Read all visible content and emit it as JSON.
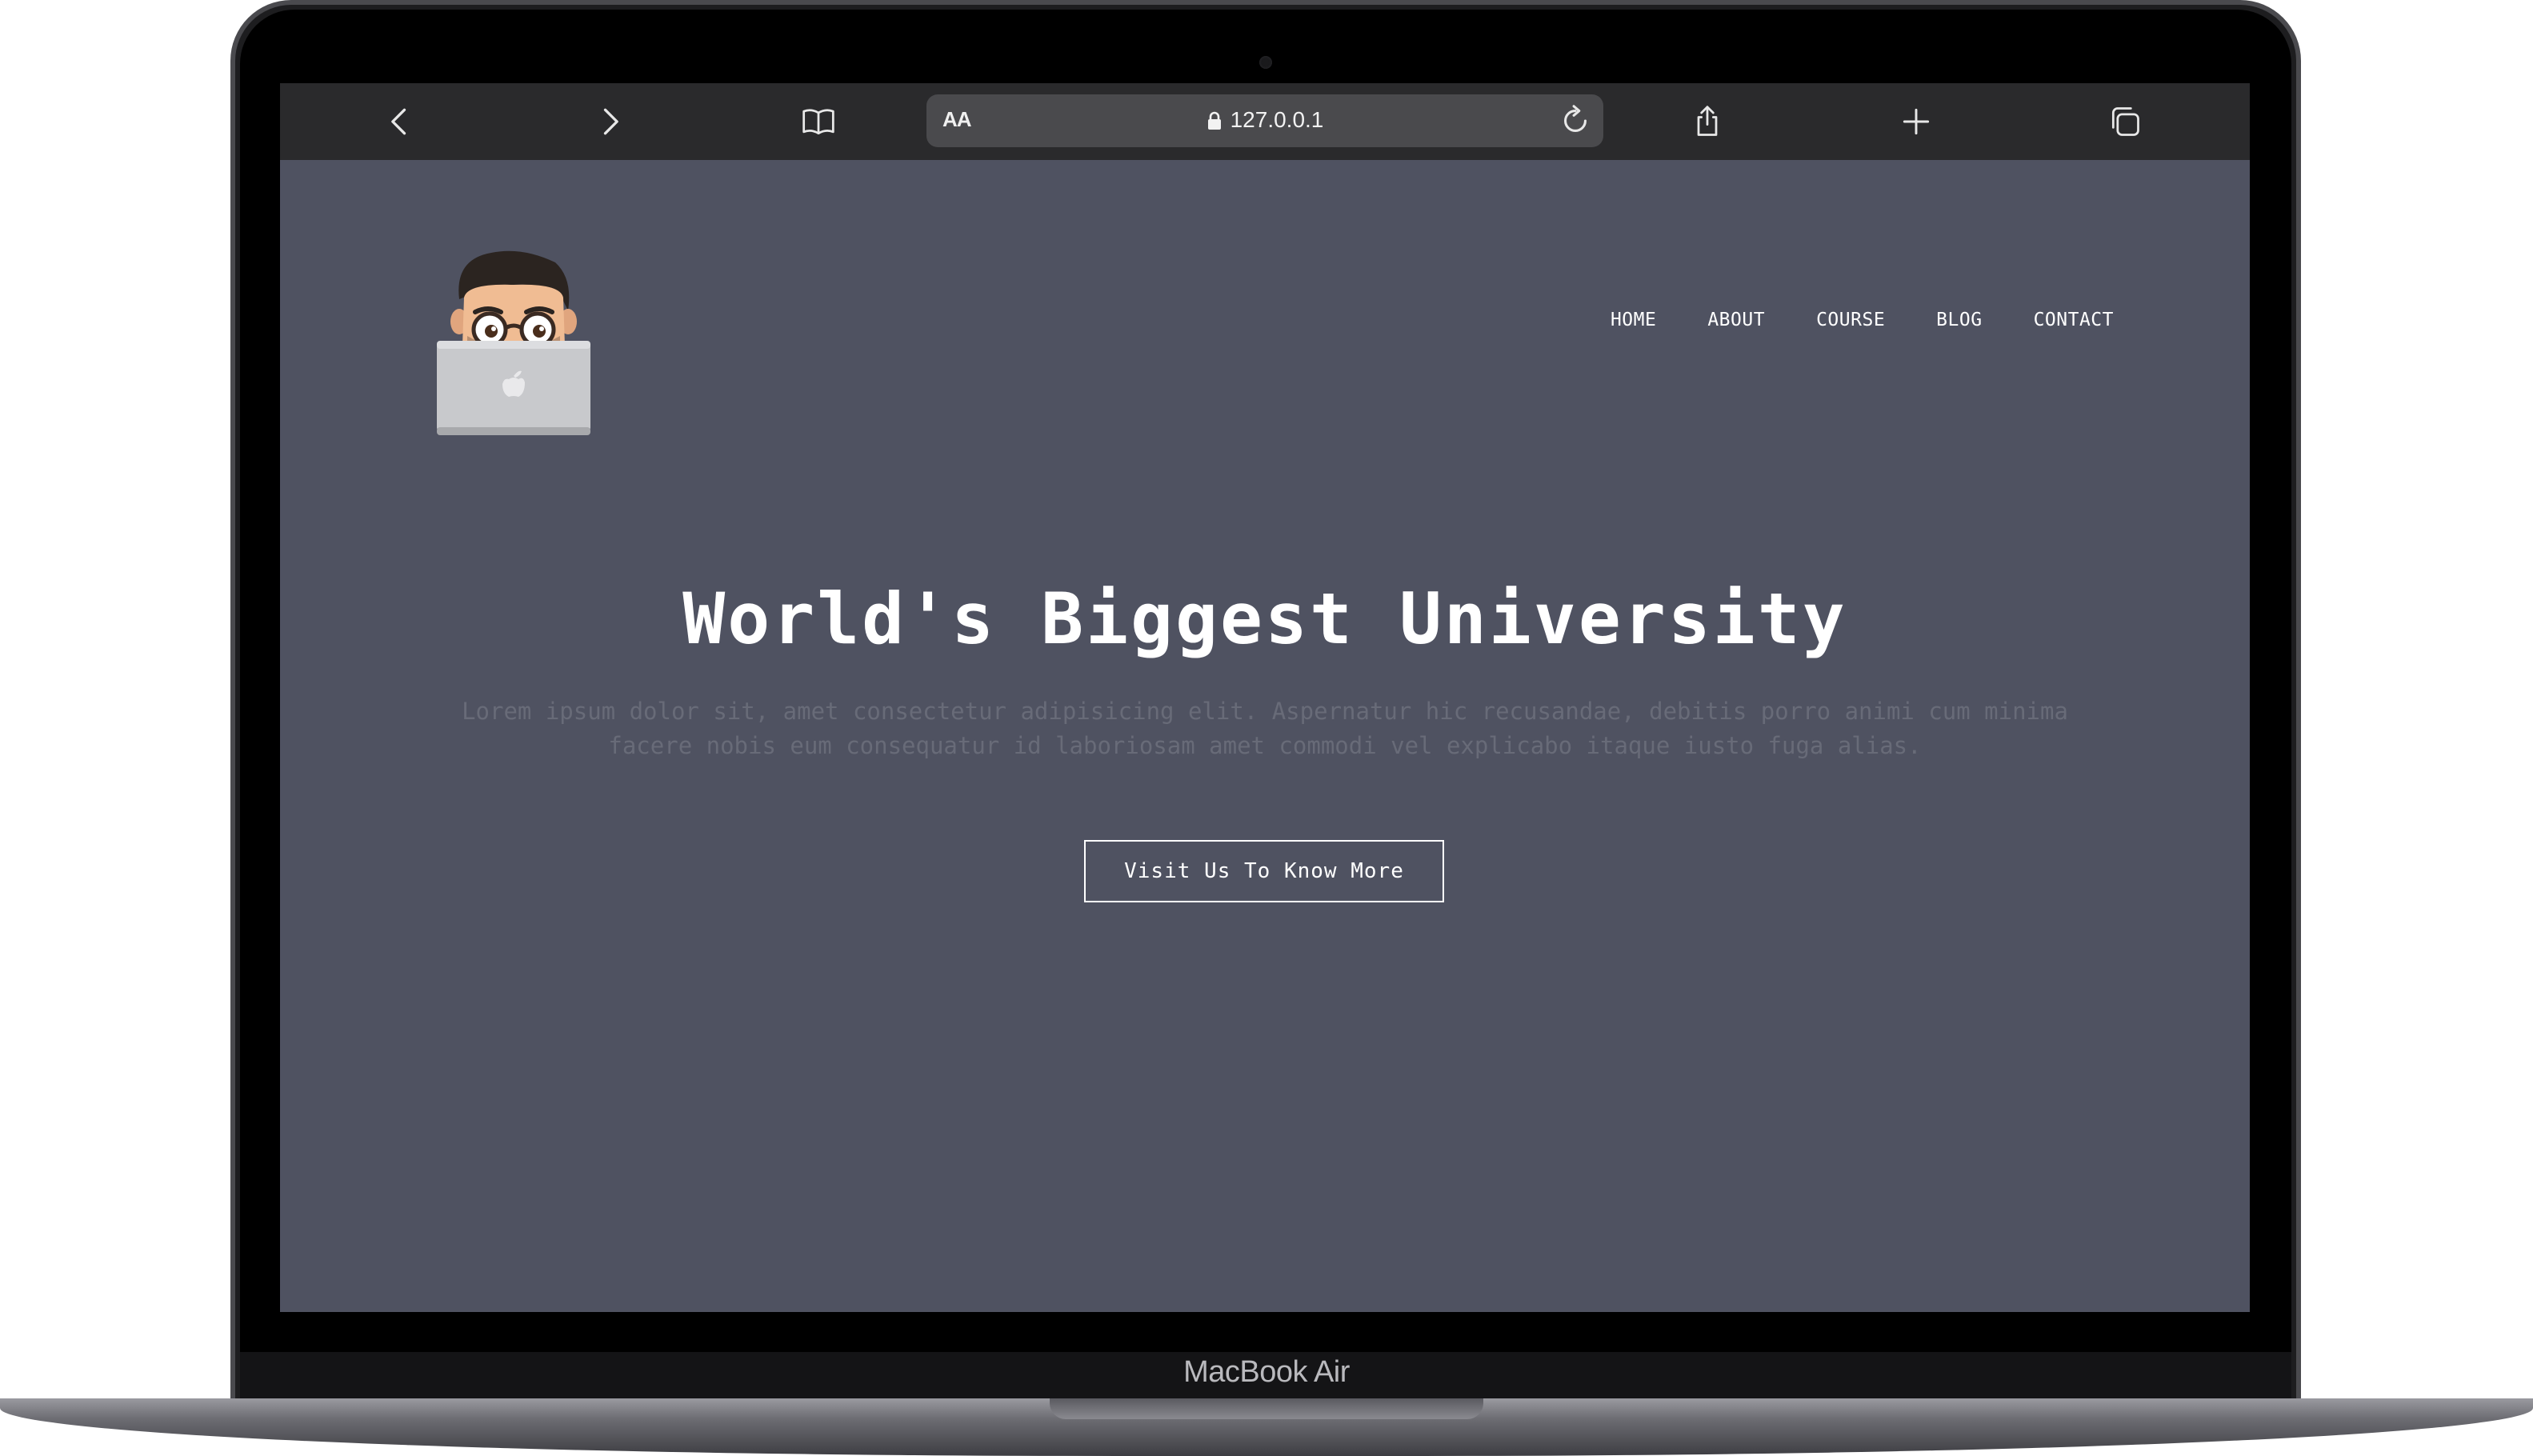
{
  "device": {
    "brand_label": "MacBook Air"
  },
  "browser": {
    "reader_label": "AA",
    "url": "127.0.0.1",
    "icons": {
      "back": "chevron-left-icon",
      "forward": "chevron-right-icon",
      "bookmarks": "book-icon",
      "lock": "lock-icon",
      "reload": "reload-icon",
      "share": "share-icon",
      "new_tab": "plus-icon",
      "tabs": "tabs-icon"
    }
  },
  "site": {
    "nav": [
      {
        "label": "HOME"
      },
      {
        "label": "ABOUT"
      },
      {
        "label": "COURSE"
      },
      {
        "label": "BLOG"
      },
      {
        "label": "CONTACT"
      }
    ],
    "hero": {
      "title": "World's Biggest University",
      "text_line1": "Lorem ipsum dolor sit, amet consectetur adipisicing elit. Aspernatur hic recusandae, debitis porro animi cum minima",
      "text_line2": "facere nobis eum consequatur id laboriosam amet commodi vel explicabo itaque iusto fuga alias.",
      "cta_label": "Visit Us To Know More"
    },
    "colors": {
      "page_background": "#4f5261",
      "muted_text": "#686b78",
      "toolbar": "#2a2a2c"
    }
  }
}
